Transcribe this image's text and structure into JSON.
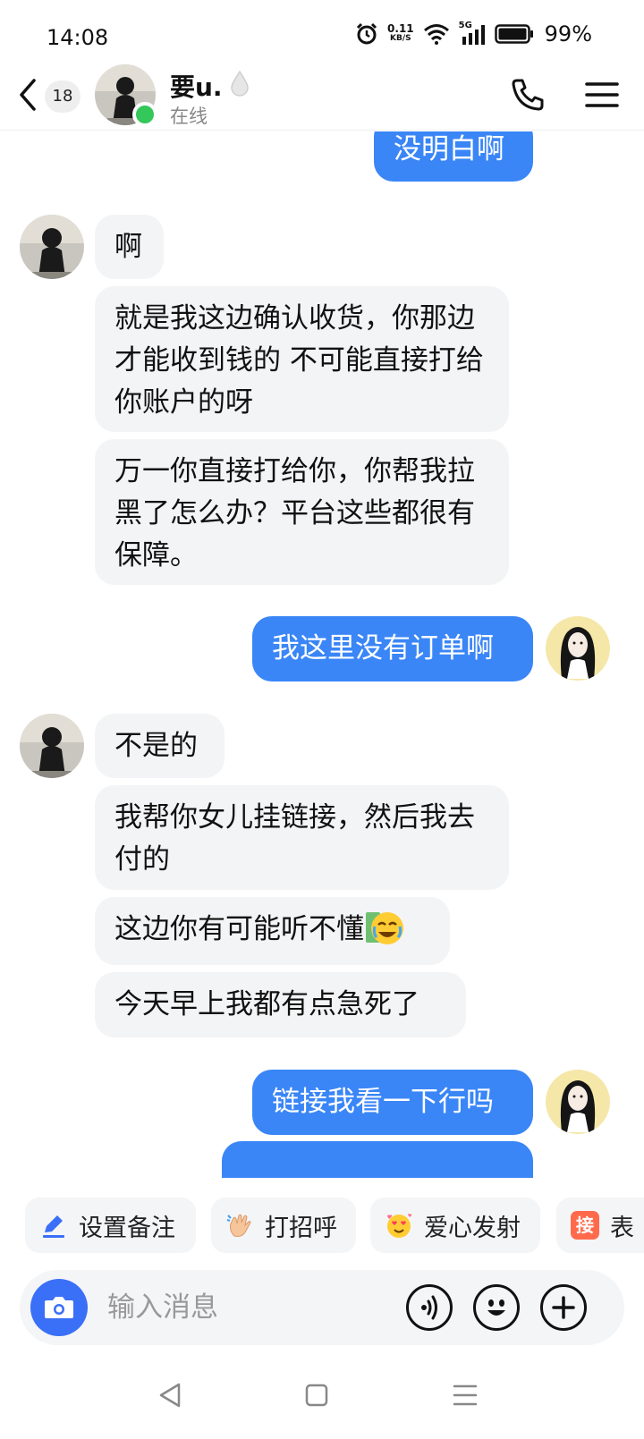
{
  "status_bar": {
    "time": "14:08",
    "net_speed_value": "0.11",
    "net_speed_unit": "KB/S",
    "signal_label": "5G",
    "battery_percent": "99%"
  },
  "header": {
    "unread_count": "18",
    "contact_name": "要u.",
    "contact_status": "在线"
  },
  "messages": [
    {
      "side": "out",
      "text": "没明白啊"
    },
    {
      "side": "in",
      "text": "啊"
    },
    {
      "side": "in",
      "text": "就是我这边确认收货，你那边才能收到钱的 不可能直接打给你账户的呀"
    },
    {
      "side": "in",
      "text": "万一你直接打给你，你帮我拉黑了怎么办？平台这些都很有保障。"
    },
    {
      "side": "out",
      "text": "我这里没有订单啊"
    },
    {
      "side": "in",
      "text": "不是的"
    },
    {
      "side": "in",
      "text": "我帮你女儿挂链接，然后我去付的"
    },
    {
      "side": "in",
      "text": "这边你有可能听不懂",
      "emoji": "laughing-crying-money-emoji"
    },
    {
      "side": "in",
      "text": "今天早上我都有点急死了"
    },
    {
      "side": "out",
      "text": "链接我看一下行吗"
    }
  ],
  "quick_actions": [
    {
      "label": "设置备注",
      "icon": "pencil-icon"
    },
    {
      "label": "打招呼",
      "icon": "waving-hand-icon"
    },
    {
      "label": "爱心发射",
      "icon": "heart-eyes-emoji-icon"
    },
    {
      "label": "表",
      "icon": "jie-badge-icon",
      "badge_text": "接"
    }
  ],
  "input": {
    "placeholder": "输入消息"
  },
  "colors": {
    "outgoing_bubble": "#3a86f7",
    "incoming_bubble": "#f3f4f6",
    "online_dot": "#34c759",
    "camera_button": "#3a6ff7"
  }
}
